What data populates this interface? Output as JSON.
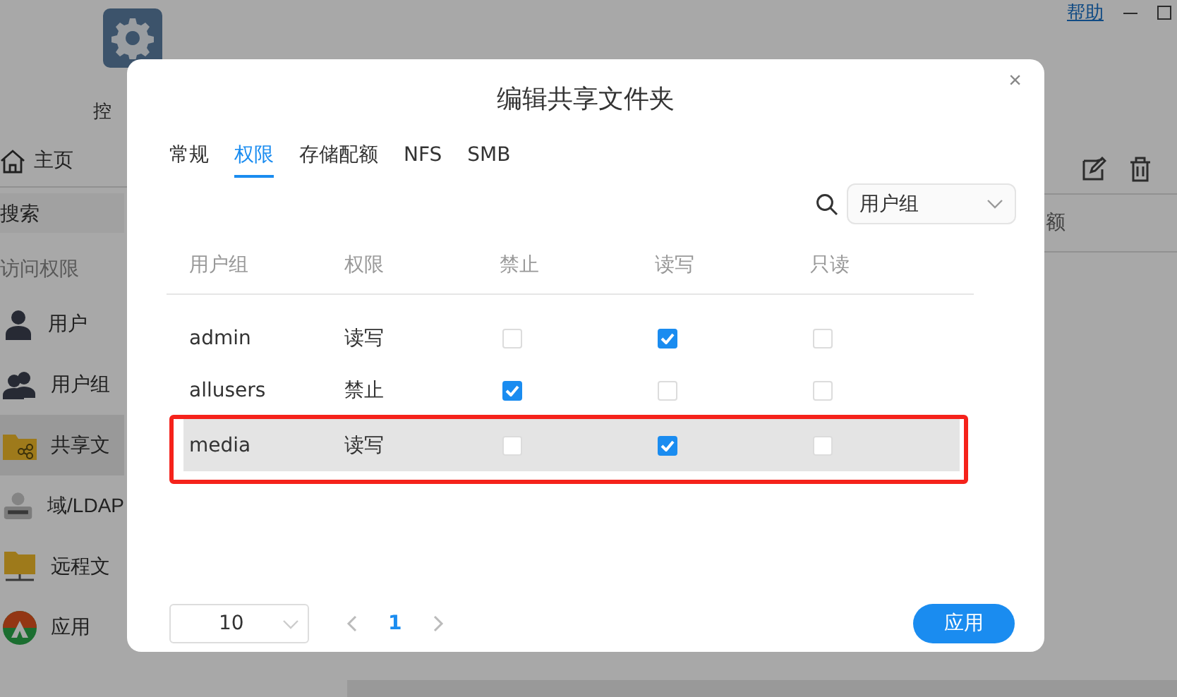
{
  "app": {
    "header": {
      "icon_label": "控",
      "help_link": "帮助"
    },
    "sidebar": {
      "home": "主页",
      "search": {
        "placeholder": "搜索"
      },
      "section": "访问权限",
      "items": [
        {
          "label": "用户",
          "kind": "user",
          "selected": false
        },
        {
          "label": "用户组",
          "kind": "group",
          "selected": false
        },
        {
          "label": "共享文",
          "kind": "shared",
          "selected": true
        },
        {
          "label": "域/LDAP",
          "kind": "directory",
          "selected": false
        },
        {
          "label": "远程文",
          "kind": "remote",
          "selected": false
        },
        {
          "label": "应用",
          "kind": "app",
          "selected": false
        }
      ]
    },
    "main": {
      "column_header": "额"
    }
  },
  "dialog": {
    "title": "编辑共享文件夹",
    "close_icon": "×",
    "tabs": [
      {
        "label": "常规",
        "selected": false
      },
      {
        "label": "权限",
        "selected": true
      },
      {
        "label": "存储配额",
        "selected": false
      },
      {
        "label": "NFS",
        "selected": false
      },
      {
        "label": "SMB",
        "selected": false
      }
    ],
    "filter": {
      "value": "用户组"
    },
    "table": {
      "columns": [
        "用户组",
        "权限",
        "禁止",
        "读写",
        "只读"
      ],
      "rows": [
        {
          "name": "admin",
          "permission": "读写",
          "deny": false,
          "read_write": true,
          "read_only": false,
          "highlighted": false
        },
        {
          "name": "allusers",
          "permission": "禁止",
          "deny": true,
          "read_write": false,
          "read_only": false,
          "highlighted": false
        },
        {
          "name": "media",
          "permission": "读写",
          "deny": false,
          "read_write": true,
          "read_only": false,
          "highlighted": true
        }
      ]
    },
    "pagination": {
      "page_size": "10",
      "pages": [
        {
          "label": "1",
          "selected": true
        }
      ]
    },
    "apply_button": "应用"
  }
}
